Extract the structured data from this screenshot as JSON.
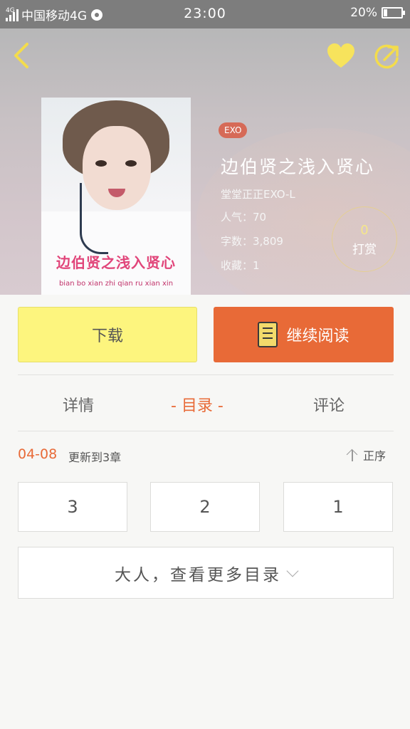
{
  "status_bar": {
    "carrier": "中国移动4G",
    "network_small": "4G",
    "time": "23:00",
    "battery": "20%"
  },
  "book": {
    "tag": "EXO",
    "title": "边伯贤之浅入贤心",
    "author": "堂堂正正EXO-L",
    "popularity": "人气：70",
    "word_count": "字数：3,809",
    "favorites": "收藏：1",
    "cover_title": "边伯贤之浅入贤心",
    "cover_pinyin": "bian bo xian zhi qian ru xian xin"
  },
  "tip": {
    "count": "0",
    "label": "打赏"
  },
  "actions": {
    "download": "下载",
    "continue_reading": "继续阅读"
  },
  "tabs": {
    "details": "详情",
    "catalog": "- 目录 -",
    "comments": "评论"
  },
  "catalog": {
    "update_date": "04-08",
    "update_text": "更新到3章",
    "sort_label": "正序",
    "chapters": [
      "3",
      "2",
      "1"
    ],
    "more_label": "大人，查看更多目录"
  },
  "colors": {
    "accent": "#e86a37",
    "download_bg": "#fdf57e",
    "heart": "#f7e35c",
    "tag_bg": "#d66a57"
  }
}
